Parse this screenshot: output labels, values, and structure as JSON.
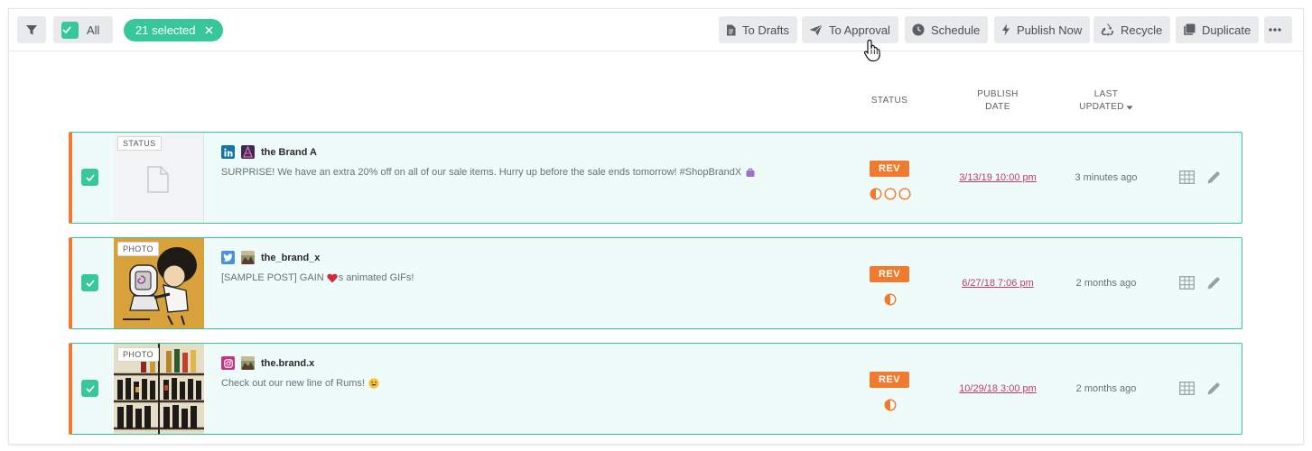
{
  "toolbar": {
    "all_label": "All",
    "selected_label": "21 selected",
    "actions": [
      {
        "label": "To Drafts",
        "icon": "document-icon"
      },
      {
        "label": "To Approval",
        "icon": "paper-plane-icon"
      },
      {
        "label": "Schedule",
        "icon": "clock-icon"
      },
      {
        "label": "Publish Now",
        "icon": "lightning-icon"
      },
      {
        "label": "Recycle",
        "icon": "recycle-icon"
      },
      {
        "label": "Duplicate",
        "icon": "duplicate-icon"
      }
    ],
    "more_label": "•••"
  },
  "columns": {
    "status": "STATUS",
    "publish_date_line1": "PUBLISH",
    "publish_date_line2": "DATE",
    "last_updated_line1": "LAST",
    "last_updated_line2": "UPDATED"
  },
  "posts": [
    {
      "type_label": "STATUS",
      "network": "linkedin",
      "handle": "the Brand A",
      "text": "SURPRISE! We have an extra 20% off on all of our sale items. Hurry up before the sale ends tomorrow! #ShopBrandX",
      "status": "REV",
      "publish_date": "3/13/19 10:00 pm",
      "last_updated": "3 minutes ago"
    },
    {
      "type_label": "PHOTO",
      "network": "twitter",
      "handle": "the_brand_x",
      "text_before": "[SAMPLE POST] GAIN",
      "text_after": "s animated GIFs!",
      "status": "REV",
      "publish_date": "6/27/18 7:06 pm",
      "last_updated": "2 months ago"
    },
    {
      "type_label": "PHOTO",
      "network": "instagram",
      "handle": "the.brand.x",
      "text": "Check out our new line of Rums!",
      "status": "REV",
      "publish_date": "10/29/18 3:00 pm",
      "last_updated": "2 months ago"
    }
  ],
  "colors": {
    "accent_green": "#38c79b",
    "status_orange": "#f07b2e",
    "date_link": "#c03a6b",
    "row_bg": "#effbf8"
  }
}
